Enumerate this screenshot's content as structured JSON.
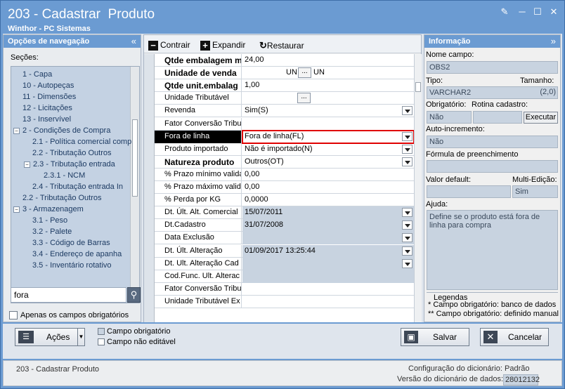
{
  "window": {
    "title": "203 - Cadastrar  Produto",
    "subtitle": "Winthor - PC Sistemas"
  },
  "nav": {
    "header": "Opções de navegação",
    "sections_label": "Seções:",
    "tree": [
      "1 - Capa",
      "10 - Autopeças",
      "11 - Dimensões",
      "12 - Licitações",
      "13 - Inservível",
      "2 - Condições de Compra",
      "2.1 - Política comercial comp",
      "2.2 - Tributação Outros",
      "2.3 - Tributação entrada",
      "2.3.1 - NCM",
      "2.4 - Tributação entrada In",
      "2.2 - Tributação Outros",
      "3 - Armazenagem",
      "3.1 - Peso",
      "3.2 - Palete",
      "3.3 - Código de Barras",
      "3.4 - Endereço de apanha",
      "3.5 - Inventário rotativo"
    ],
    "search_value": "fora",
    "only_required_label": "Apenas os campos obrigatórios"
  },
  "toolbar": {
    "collapse": "Contrair",
    "expand": "Expandir",
    "restore": "Restaurar"
  },
  "grid": [
    {
      "label": "Qtde embalagem m",
      "value": "24,00",
      "bold": true
    },
    {
      "label": "Unidade de venda",
      "value": "UN",
      "bold": true
    },
    {
      "label": "Qtde unit.embalag",
      "value": "1,00",
      "bold": true
    },
    {
      "label": "Unidade Tributável",
      "value": ""
    },
    {
      "label": "Revenda",
      "value": "Sim(S)"
    },
    {
      "label": "Fator Conversão Tribu",
      "value": ""
    },
    {
      "label": "Fora de linha",
      "value": "Fora de linha(FL)"
    },
    {
      "label": "Produto importado",
      "value": "Não é importado(N)"
    },
    {
      "label": "Natureza produto",
      "value": "Outros(OT)",
      "bold": true
    },
    {
      "label": "% Prazo mínimo valida",
      "value": "0,00"
    },
    {
      "label": "% Prazo máximo valida",
      "value": "0,00"
    },
    {
      "label": "% Perda por KG",
      "value": "0,0000"
    },
    {
      "label": "Dt. Últ. Alt. Comercial",
      "value": "15/07/2011"
    },
    {
      "label": "Dt.Cadastro",
      "value": "31/07/2008"
    },
    {
      "label": "Data Exclusão",
      "value": ""
    },
    {
      "label": "Dt. Últ. Alteração",
      "value": "01/09/2017 13:25:44"
    },
    {
      "label": "Dt. Ult. Alteração Cad",
      "value": ""
    },
    {
      "label": "Cod.Func. Ult. Alterac",
      "value": ""
    },
    {
      "label": "Fator Conversão Tribu",
      "value": ""
    },
    {
      "label": "Unidade Tributável Ex",
      "value": ""
    }
  ],
  "unit_extra": "UN",
  "info": {
    "header": "Informação",
    "field_name_label": "Nome campo:",
    "field_name": "OBS2",
    "type_label": "Tipo:",
    "type": "VARCHAR2",
    "size_label": "Tamanho:",
    "size": "(2,0)",
    "required_label": "Obrigatório:",
    "required": "Não",
    "routine_label": "Rotina cadastro:",
    "execute": "Executar",
    "autoinc_label": "Auto-incremento:",
    "autoinc": "Não",
    "formula_label": "Fórmula de preenchimento",
    "default_label": "Valor default:",
    "multi_label": "Multi-Edição:",
    "multi": "Sim",
    "help_label": "Ajuda:",
    "help": "Define se o produto está fora de linha para compra",
    "legend_title": "Legendas",
    "legend1": "* Campo obrigatório: banco de dados",
    "legend2": "** Campo obrigatório: definido manual"
  },
  "bottom": {
    "actions": "Ações",
    "required_field": "Campo obrigatório",
    "non_editable": "Campo não editável",
    "save": "Salvar",
    "cancel": "Cancelar"
  },
  "status": {
    "left": "203 - Cadastrar  Produto",
    "config_label": "Configuração do dicionário:",
    "config_value": "Padrão",
    "version_label": "Versão do dicionário de dados:",
    "version_value": "28012132"
  }
}
